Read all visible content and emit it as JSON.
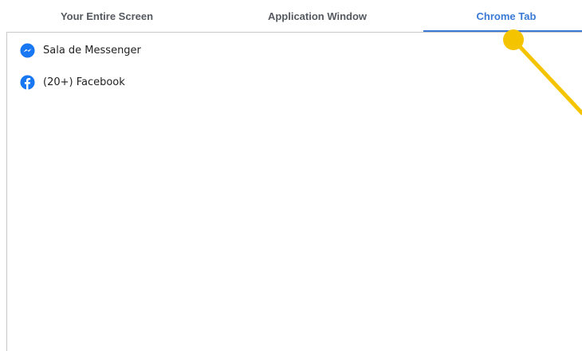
{
  "tabs": [
    {
      "label": "Your Entire Screen",
      "active": false
    },
    {
      "label": "Application Window",
      "active": false
    },
    {
      "label": "Chrome Tab",
      "active": true
    }
  ],
  "accent_color": "#3a7ad6",
  "pointer_color": "#f5c400",
  "items": [
    {
      "label": "Sala de Messenger",
      "icon": "messenger-icon"
    },
    {
      "label": "(20+) Facebook",
      "icon": "facebook-icon"
    }
  ]
}
